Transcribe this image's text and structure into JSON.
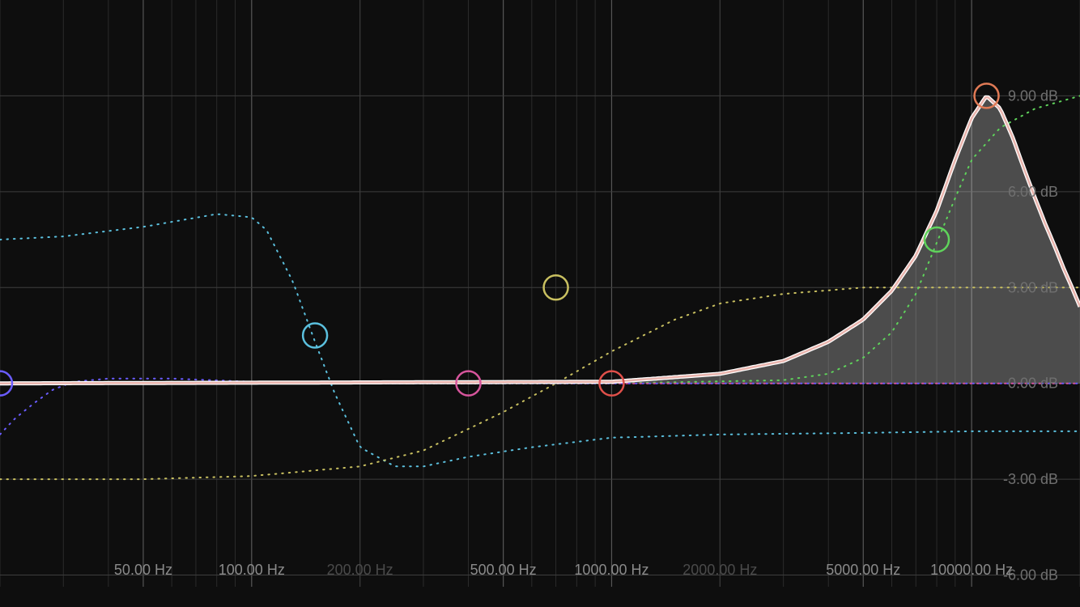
{
  "chart_data": {
    "type": "line",
    "title": "",
    "xlabel": "",
    "ylabel": "",
    "x_scale": "log",
    "xlim": [
      20,
      20000
    ],
    "ylim": [
      -7,
      12
    ],
    "x_ticks": [
      {
        "value": 50,
        "label": "50.00 Hz",
        "emphasis": "bright"
      },
      {
        "value": 100,
        "label": "100.00 Hz",
        "emphasis": "bright"
      },
      {
        "value": 200,
        "label": "200.00 Hz",
        "emphasis": "dim"
      },
      {
        "value": 500,
        "label": "500.00 Hz",
        "emphasis": "bright"
      },
      {
        "value": 1000,
        "label": "1000.00 Hz",
        "emphasis": "bright"
      },
      {
        "value": 2000,
        "label": "2000.00 Hz",
        "emphasis": "dim"
      },
      {
        "value": 5000,
        "label": "5000.00 Hz",
        "emphasis": "bright"
      },
      {
        "value": 10000,
        "label": "10000.00 Hz",
        "emphasis": "bright"
      }
    ],
    "y_ticks": [
      {
        "value": 9,
        "label": "9.00 dB"
      },
      {
        "value": 6,
        "label": "6.00 dB"
      },
      {
        "value": 3,
        "label": "3.00 dB"
      },
      {
        "value": 0,
        "label": "0.00 dB"
      },
      {
        "value": -3,
        "label": "-3.00 dB"
      },
      {
        "value": -6,
        "label": "-6.00 dB"
      }
    ],
    "grid": true,
    "bands": [
      {
        "name": "",
        "color": "#6a5cff",
        "freq": 20,
        "gain": 0
      },
      {
        "name": "",
        "color": "#5bc0de",
        "freq": 150,
        "gain": 1.5
      },
      {
        "name": "",
        "color": "#d6559c",
        "freq": 400,
        "gain": 0
      },
      {
        "name": "",
        "color": "#c9c060",
        "freq": 700,
        "gain": 3
      },
      {
        "name": "",
        "color": "#e0504a",
        "freq": 1000,
        "gain": 0
      },
      {
        "name": "",
        "color": "#5fd35b",
        "freq": 8000,
        "gain": 4.5
      },
      {
        "name": "",
        "color": "#e07a55",
        "freq": 11000,
        "gain": 9
      }
    ],
    "series": [
      {
        "name": "",
        "color": "#e9b4ad",
        "style": "solid",
        "fill": true,
        "x": [
          20,
          1000,
          2000,
          3000,
          4000,
          5000,
          6000,
          7000,
          8000,
          9000,
          10000,
          11000,
          12000,
          13000,
          14000,
          15000,
          16000,
          17000,
          18000,
          19000,
          20000
        ],
        "y": [
          0,
          0.05,
          0.3,
          0.7,
          1.3,
          2.0,
          2.9,
          4.0,
          5.4,
          7.0,
          8.3,
          9.0,
          8.6,
          7.7,
          6.7,
          5.8,
          5.0,
          4.3,
          3.6,
          3.0,
          2.4
        ]
      },
      {
        "name": "",
        "color": "#5bc0de",
        "style": "dotted",
        "x": [
          20,
          30,
          50,
          80,
          100,
          110,
          130,
          150,
          170,
          200,
          250,
          300,
          400,
          600,
          1000,
          2000,
          5000,
          10000,
          20000
        ],
        "y": [
          4.5,
          4.6,
          4.9,
          5.3,
          5.2,
          4.8,
          3.2,
          1.3,
          -0.3,
          -2.0,
          -2.6,
          -2.6,
          -2.3,
          -2.0,
          -1.7,
          -1.6,
          -1.55,
          -1.5,
          -1.5
        ]
      },
      {
        "name": "",
        "color": "#c9c060",
        "style": "dotted",
        "x": [
          20,
          50,
          100,
          200,
          300,
          500,
          700,
          1000,
          1500,
          2000,
          3000,
          5000,
          10000,
          20000
        ],
        "y": [
          -3.0,
          -3.0,
          -2.9,
          -2.6,
          -2.1,
          -0.9,
          0,
          1.0,
          2.0,
          2.5,
          2.8,
          3.0,
          3.0,
          3.0
        ]
      },
      {
        "name": "",
        "color": "#5fd35b",
        "style": "dotted",
        "x": [
          20,
          1000,
          3000,
          4000,
          5000,
          6000,
          7000,
          8000,
          9000,
          10000,
          12000,
          15000,
          20000
        ],
        "y": [
          0,
          0,
          0.1,
          0.3,
          0.8,
          1.6,
          2.8,
          4.4,
          5.8,
          7.0,
          8.0,
          8.6,
          9.0
        ]
      },
      {
        "name": "",
        "color": "#6a5cff",
        "style": "dotted",
        "x": [
          20,
          22,
          25,
          28,
          32,
          40,
          60,
          100,
          200,
          20000
        ],
        "y": [
          -1.6,
          -1.1,
          -0.6,
          -0.2,
          0.05,
          0.15,
          0.15,
          0.05,
          0,
          0
        ]
      },
      {
        "name": "",
        "color": "#d6559c",
        "style": "dotted",
        "x": [
          20,
          20000
        ],
        "y": [
          0,
          0
        ]
      }
    ]
  }
}
